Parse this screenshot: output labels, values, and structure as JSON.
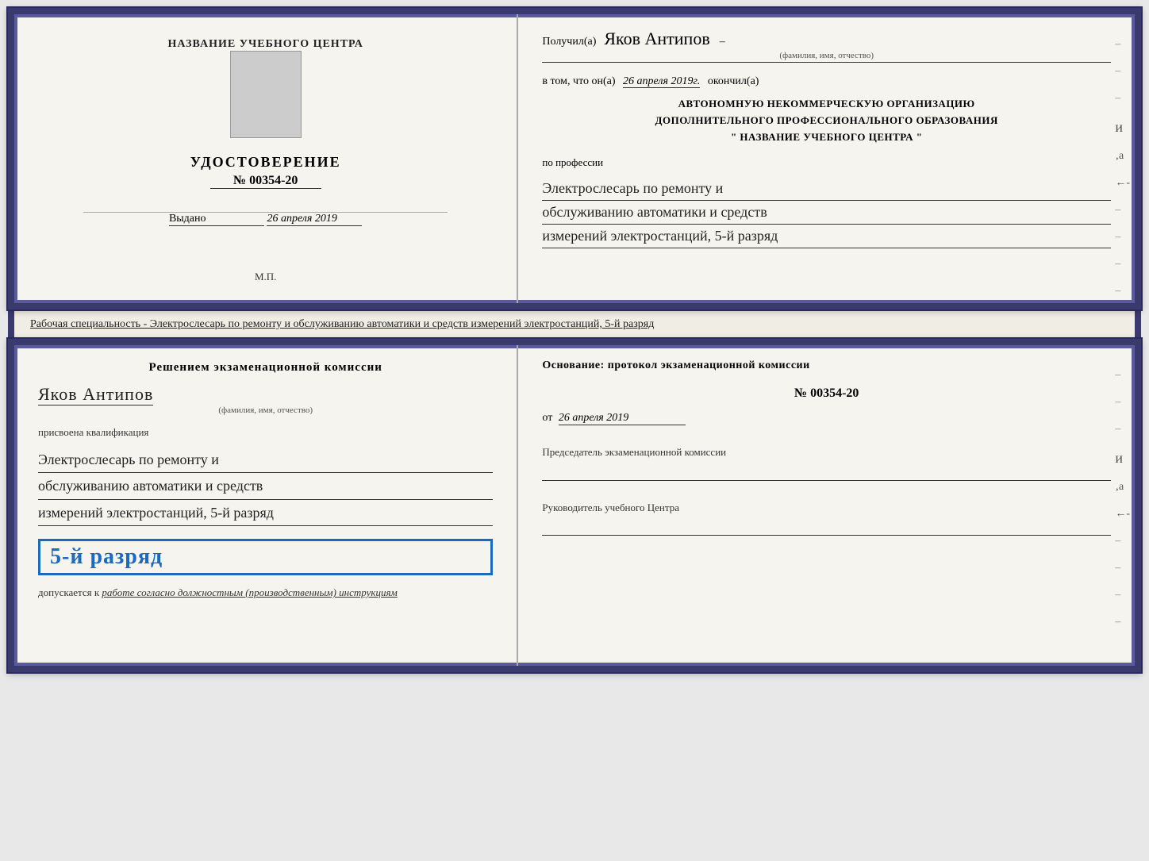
{
  "page": {
    "background_color": "#e8e8e8"
  },
  "top_diploma": {
    "left": {
      "center_title": "НАЗВАНИЕ УЧЕБНОГО ЦЕНТРА",
      "udostoverenie_label": "УДОСТОВЕРЕНИЕ",
      "udostoverenie_number": "№ 00354-20",
      "vydano_label": "Выдано",
      "vydano_date": "26 апреля 2019",
      "mp_label": "М.П."
    },
    "right": {
      "poluchil_label": "Получил(а)",
      "poluchil_name": "Яков Антипов",
      "fio_label": "(фамилия, имя, отчество)",
      "vtom_label": "в том, что он(а)",
      "vtom_date": "26 апреля 2019г.",
      "okonchil_label": "окончил(а)",
      "org_line1": "АВТОНОМНУЮ НЕКОММЕРЧЕСКУЮ ОРГАНИЗАЦИЮ",
      "org_line2": "ДОПОЛНИТЕЛЬНОГО ПРОФЕССИОНАЛЬНОГО ОБРАЗОВАНИЯ",
      "org_line3": "\"   НАЗВАНИЕ УЧЕБНОГО ЦЕНТРА   \"",
      "po_professii_label": "по профессии",
      "profession_line1": "Электрослесарь по ремонту и",
      "profession_line2": "обслуживанию автоматики и средств",
      "profession_line3": "измерений электростанций, 5-й разряд"
    }
  },
  "middle_strip": {
    "text": "Рабочая специальность - Электрослесарь по ремонту и обслуживанию автоматики и средств измерений электростанций, 5-й разряд"
  },
  "bottom_diploma": {
    "left": {
      "resheniem_label": "Решением экзаменационной комиссии",
      "name": "Яков Антипов",
      "fio_label": "(фамилия, имя, отчество)",
      "prisvoena_label": "присвоена квалификация",
      "profession_line1": "Электрослесарь по ремонту и",
      "profession_line2": "обслуживанию автоматики и средств",
      "profession_line3": "измерений электростанций, 5-й разряд",
      "razryad_big": "5-й разряд",
      "dopuskaetsya_prefix": "допускается к",
      "dopuskaetsya_italic": "работе согласно должностным (производственным) инструкциям"
    },
    "right": {
      "osnovanie_label": "Основание: протокол экзаменационной комиссии",
      "number": "№ 00354-20",
      "ot_label": "от",
      "ot_date": "26 апреля 2019",
      "predsedatel_label": "Председатель экзаменационной комиссии",
      "rukovoditel_label": "Руководитель учебного Центра"
    }
  }
}
